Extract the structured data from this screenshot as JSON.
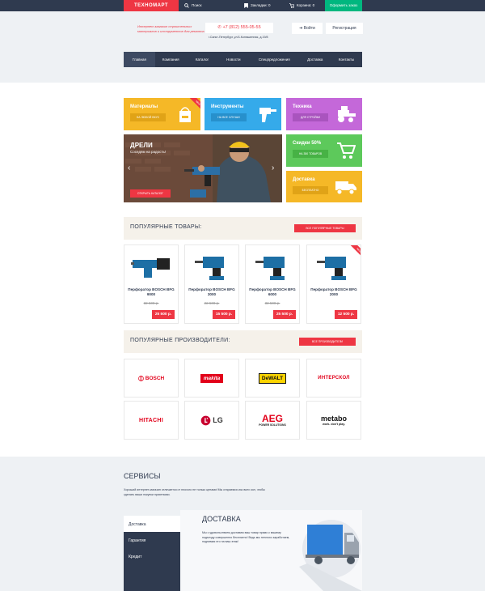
{
  "colors": {
    "accent": "#ee3643",
    "dark": "#2f3a4f",
    "green": "#00b77f"
  },
  "topbar": {
    "logo": "ТЕХНОМАРТ",
    "search": "Поиск",
    "bookmarks": "Закладки: 0",
    "cart": "Корзина: 0",
    "order": "Оформить заказ"
  },
  "header": {
    "tagline": "Интернет-магазин строительных материалов и инструментов для ремонта",
    "phone": "+7 (812) 555-05-55",
    "address": "г.Санкт-Петербург, ул.Б.Конюшенная, д.19/8",
    "login": "Войти",
    "register": "Регистрация"
  },
  "nav": [
    "Главная",
    "Компания",
    "Каталог",
    "Новости",
    "Спецпредложения",
    "Доставка",
    "Контакты"
  ],
  "tiles": {
    "materials": {
      "title": "Материалы",
      "button": "НА ЛЮБОЙ ВКУС",
      "badge": "NEW",
      "color": "#f5b827",
      "icon": "paint-bucket-icon"
    },
    "tools": {
      "title": "Инструменты",
      "button": "НА ВСЕ СЛУЧАИ",
      "color": "#35aaea",
      "icon": "drill-icon"
    },
    "machinery": {
      "title": "Техника",
      "button": "ДЛЯ СТРОЙКИ",
      "color": "#c468d9",
      "icon": "tractor-icon"
    },
    "discounts": {
      "title": "Скидки 50%",
      "button": "НА 350 ТОВАРОВ",
      "color": "#5dc95b",
      "icon": "cart-icon"
    },
    "delivery": {
      "title": "Доставка",
      "button": "БЕСПЛАТНО",
      "color": "#f5b827",
      "icon": "truck-icon"
    }
  },
  "slider": {
    "title": "ДРЕЛИ",
    "subtitle": "Соседям на радость!",
    "button": "ОТКРЫТЬ КАТАЛОГ"
  },
  "popular": {
    "title": "ПОПУЛЯРНЫЕ ТОВАРЫ:",
    "button": "ВСЕ ПОПУЛЯРНЫЕ ТОВАРЫ",
    "products": [
      {
        "name": "Перфоратор BOSCH BFG 9000",
        "old": "32 500 р.",
        "price": "25 500 р.",
        "badge": ""
      },
      {
        "name": "Перфоратор BOSCH BFG 3000",
        "old": "22 500 р.",
        "price": "15 500 р.",
        "badge": ""
      },
      {
        "name": "Перфоратор BOSCH BFG 6000",
        "old": "32 500 р.",
        "price": "25 500 р.",
        "badge": ""
      },
      {
        "name": "Перфоратор BOSCH BFG 2000",
        "old": "",
        "price": "12 500 р.",
        "badge": "NEW"
      }
    ]
  },
  "brands": {
    "title": "ПОПУЛЯРНЫЕ ПРОИЗВОДИТЕЛИ:",
    "button": "ВСЕ ПРОИЗВОДИТЕЛИ",
    "items": [
      {
        "name": "BOSCH",
        "sub": ""
      },
      {
        "name": "makita",
        "sub": ""
      },
      {
        "name": "DeWALT",
        "sub": ""
      },
      {
        "name": "ИНТЕРСКОЛ",
        "sub": ""
      },
      {
        "name": "HITACHI",
        "sub": ""
      },
      {
        "name": "LG",
        "sub": ""
      },
      {
        "name": "AEG",
        "sub": "POWER SOLUTIONS"
      },
      {
        "name": "metabo",
        "sub": "work. don't play."
      }
    ]
  },
  "services": {
    "title": "СЕРВИСЫ",
    "text": "Хороший интернет-магазин отличается от плохого не только ценами! Мы стараемся изо всех сил, чтобы сделать ваши покупки приятными.",
    "tabs": [
      "Доставка",
      "Гарантия",
      "Кредит"
    ],
    "panel_title": "ДОСТАВКА",
    "panel_text": "Мы с удовольствием доставим ваш товар прямо к вашему подъезду совершенно бесплатно! Ведь мы неплохо заработаем, поднимая его на ваш этаж!"
  }
}
